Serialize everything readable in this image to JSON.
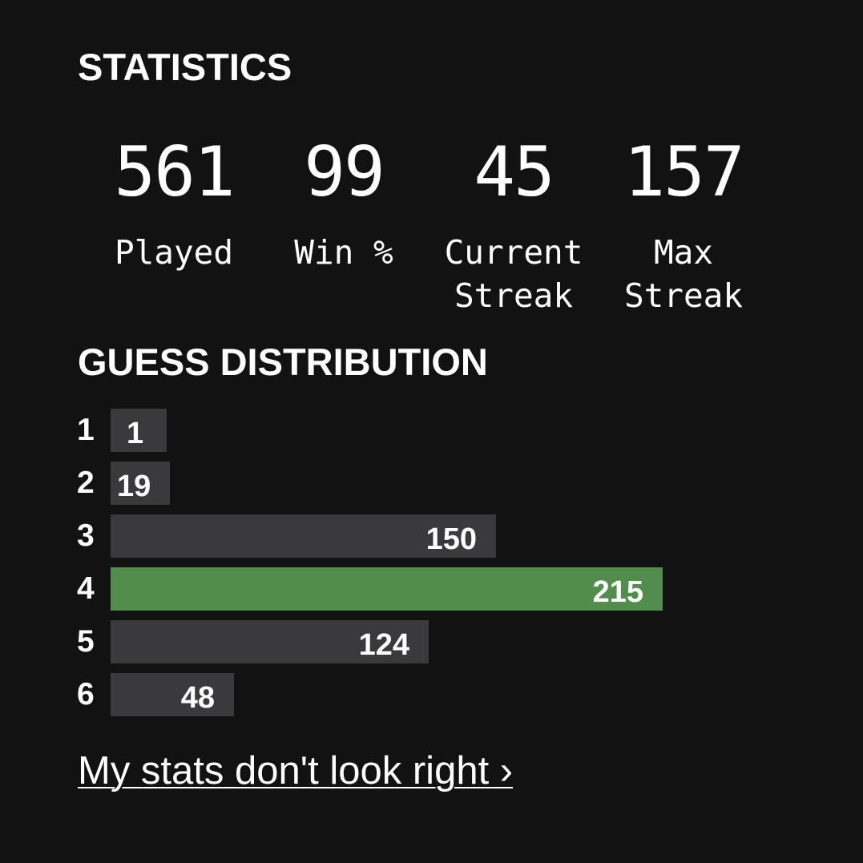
{
  "statistics": {
    "title": "STATISTICS",
    "items": [
      {
        "value": "561",
        "label": "Played"
      },
      {
        "value": "99",
        "label": "Win %"
      },
      {
        "value": "45",
        "label": "Current\nStreak"
      },
      {
        "value": "157",
        "label": "Max\nStreak"
      }
    ]
  },
  "guess_distribution": {
    "title": "GUESS DISTRIBUTION",
    "max_count": 215,
    "highlighted_guess": 4,
    "rows": [
      {
        "guess": "1",
        "count": 1
      },
      {
        "guess": "2",
        "count": 19
      },
      {
        "guess": "3",
        "count": 150
      },
      {
        "guess": "4",
        "count": 215
      },
      {
        "guess": "5",
        "count": 124
      },
      {
        "guess": "6",
        "count": 48
      }
    ]
  },
  "colors": {
    "background": "#121213",
    "bar_default": "#3a3a3c",
    "bar_highlight": "#538d4e",
    "text": "#ffffff"
  },
  "footer": {
    "link_text": "My stats don't look right ›"
  }
}
